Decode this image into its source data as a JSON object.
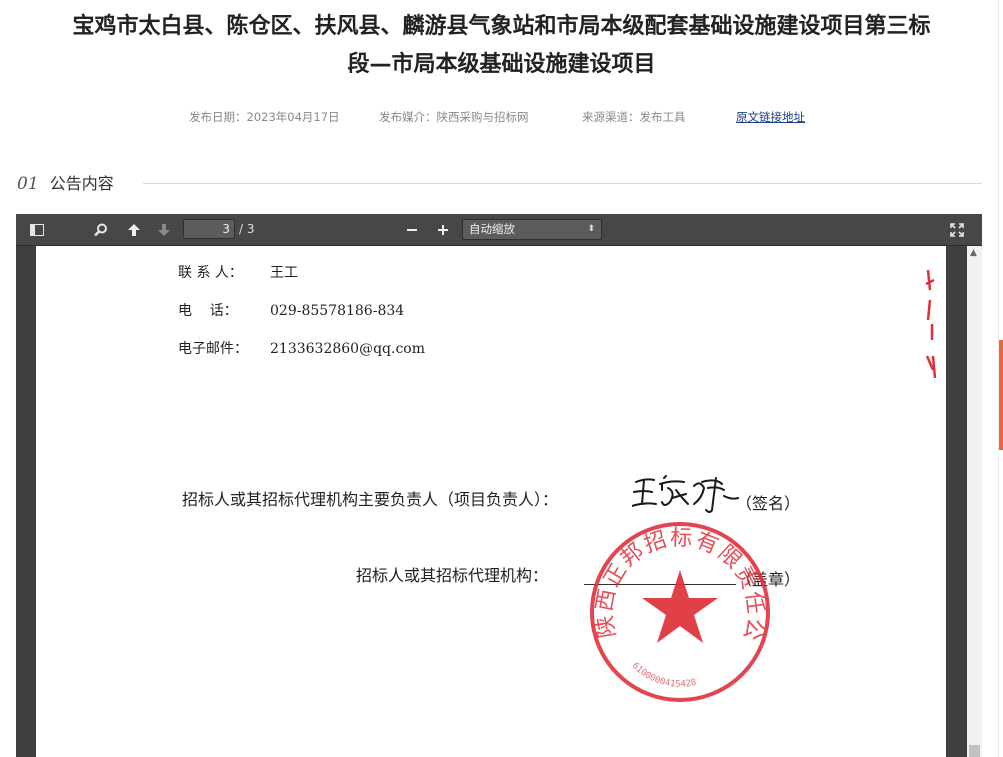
{
  "title_line1": "宝鸡市太白县、陈仓区、扶风县、麟游县气象站和市局本级配套基础设施建设项目第三标",
  "title_line2": "段—市局本级基础设施建设项目",
  "meta": {
    "date": "发布日期：2023年04月17日",
    "media": "发布媒介：陕西采购与招标网",
    "channel": "来源渠道：发布工具",
    "link": "原文链接地址"
  },
  "section": {
    "num": "01",
    "label": "公告内容"
  },
  "viewer": {
    "page_current": "3",
    "page_total": "/ 3",
    "zoom": "自动缩放",
    "icons": {
      "sidebar": "sidebar-toggle-icon",
      "search": "search-icon",
      "prev": "arrow-up-icon",
      "next": "arrow-down-icon",
      "zoom_out": "minus-icon",
      "zoom_in": "plus-icon",
      "fullscreen": "fullscreen-icon"
    }
  },
  "document": {
    "contact_label": "联 系 人：",
    "contact_value": "王工",
    "phone_label": "电    话：",
    "phone_value": "029-85578186-834",
    "email_label": "电子邮件：",
    "email_value": "2133632860@qq.com",
    "responsible_text": "招标人或其招标代理机构主要负责人（项目负责人）：",
    "signature_text": "王寇婷",
    "sign_suffix": "（签名）",
    "agency_text": "招标人或其招标代理机构：",
    "seal_suffix": "（盖章）",
    "seal_name": "陕西正邦招标有限责任公司",
    "seal_number": "6100000415428"
  },
  "colors": {
    "seal": "#e0303a",
    "toolbar": "#474747",
    "accent_edge": "#e8683a"
  }
}
